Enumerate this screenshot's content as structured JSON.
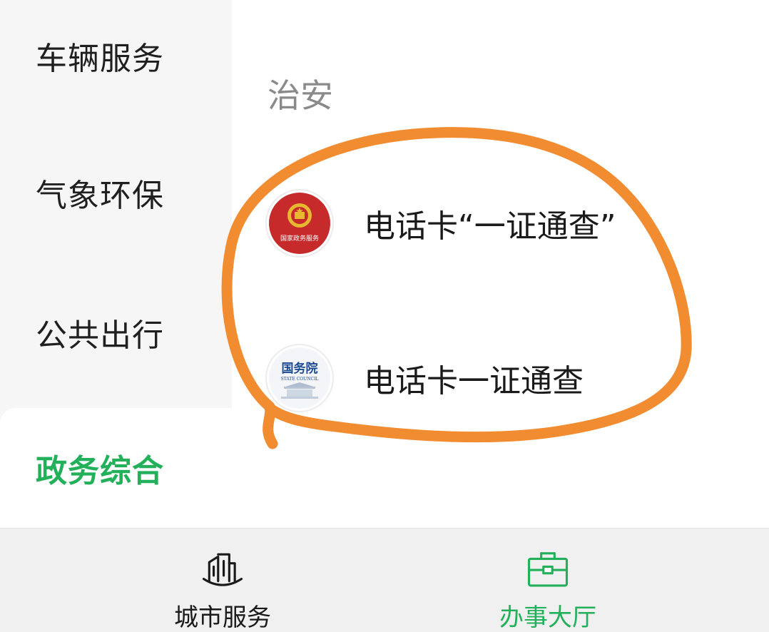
{
  "sidebar": {
    "items": [
      {
        "label": "车辆服务"
      },
      {
        "label": "气象环保"
      },
      {
        "label": "公共出行"
      },
      {
        "label": "政务综合"
      }
    ]
  },
  "main": {
    "section_title": "治安",
    "services": [
      {
        "label": "电话卡“一证通查”",
        "icon": "national-government-service-emblem-icon",
        "icon_text": "国家政务服务"
      },
      {
        "label": "电话卡一证通查",
        "icon": "state-council-logo-icon",
        "icon_text": "国务院",
        "icon_subtext": "STATE COUNCIL"
      }
    ]
  },
  "tabbar": {
    "tabs": [
      {
        "label": "城市服务",
        "icon": "buildings-icon"
      },
      {
        "label": "办事大厅",
        "icon": "briefcase-icon"
      }
    ]
  },
  "colors": {
    "accent": "#22b05a",
    "annotation": "#f28c30",
    "emblem_red": "#c62a2a",
    "state_council_blue": "#1e4b93"
  }
}
